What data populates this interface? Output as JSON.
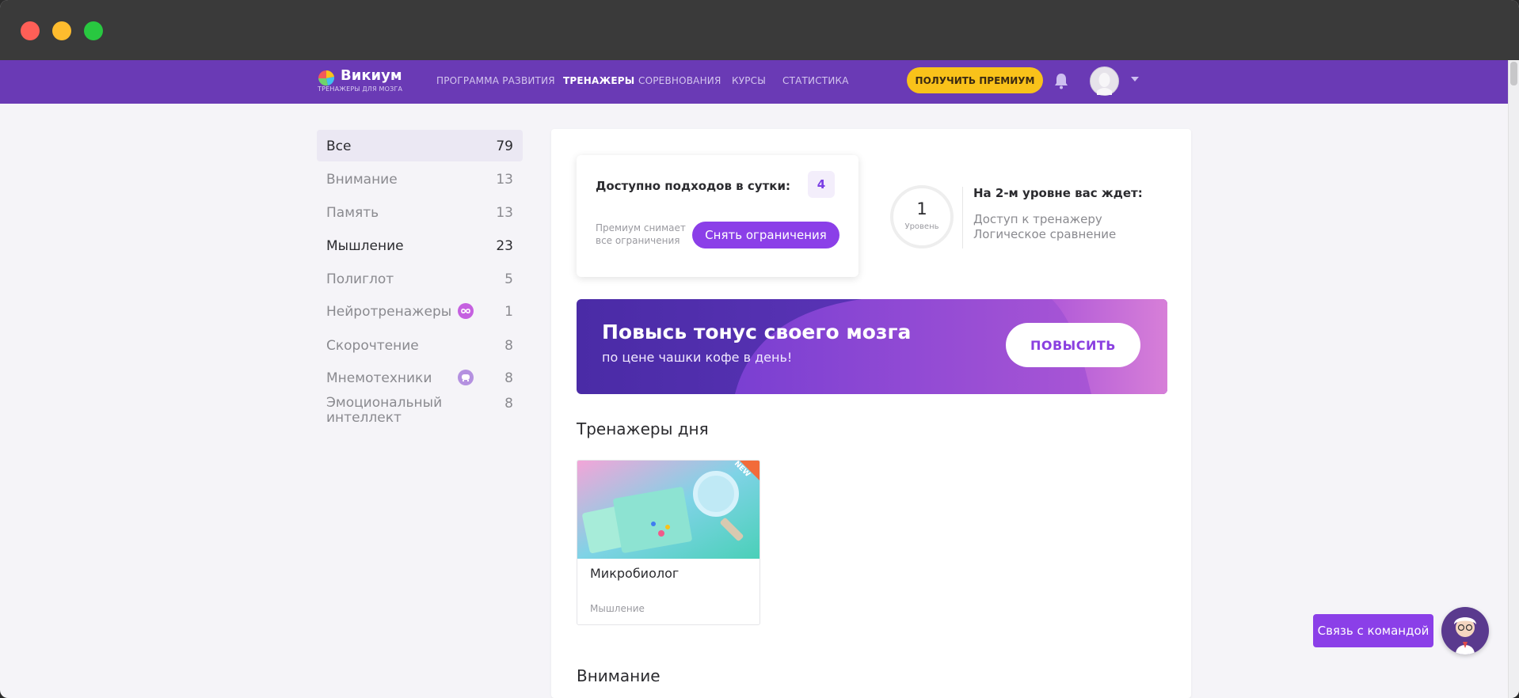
{
  "brand": {
    "title": "Викиум",
    "subtitle": "ТРЕНАЖЕРЫ ДЛЯ МОЗГА"
  },
  "nav": {
    "items": [
      {
        "label": "ПРОГРАММА РАЗВИТИЯ"
      },
      {
        "label": "ТРЕНАЖЕРЫ",
        "active": true
      },
      {
        "label": "СОРЕВНОВАНИЯ"
      },
      {
        "label": "КУРСЫ"
      },
      {
        "label": "СТАТИСТИКА"
      }
    ],
    "premium_label": "ПОЛУЧИТЬ ПРЕМИУМ"
  },
  "sidebar": {
    "items": [
      {
        "label": "Все",
        "count": "79",
        "active": true
      },
      {
        "label": "Внимание",
        "count": "13"
      },
      {
        "label": "Память",
        "count": "13"
      },
      {
        "label": "Мышление",
        "count": "23"
      },
      {
        "label": "Полиглот",
        "count": "5"
      },
      {
        "label": "Нейротренажеры",
        "count": "1",
        "badge": "infinity-icon"
      },
      {
        "label": "Скорочтение",
        "count": "8"
      },
      {
        "label": "Мнемотехники",
        "count": "8",
        "badge": "brain-icon"
      },
      {
        "label": "Эмоциональный интеллект",
        "count": "8"
      }
    ]
  },
  "limits": {
    "title": "Доступно подходов в сутки:",
    "count": "4",
    "note": "Премиум снимает все ограничения",
    "button_label": "Снять ограничения"
  },
  "level": {
    "number": "1",
    "word": "Уровень",
    "title": "На 2-м уровне вас ждет:",
    "lines": [
      "Доступ к тренажеру",
      "Логическое сравнение"
    ]
  },
  "banner": {
    "title": "Повысь тонус своего мозга",
    "subtitle": "по цене чашки кофе в день!",
    "button_label": "ПОВЫСИТЬ"
  },
  "sections": {
    "day_title": "Тренажеры дня",
    "attention_title": "Внимание"
  },
  "game": {
    "name": "Микробиолог",
    "category": "Мышление",
    "ribbon": "NEW"
  },
  "contact": {
    "label": "Связь с командой"
  },
  "colors": {
    "nav_bg": "#6a3ab5",
    "accent": "#8b3fe8",
    "premium": "#f9c21a"
  }
}
